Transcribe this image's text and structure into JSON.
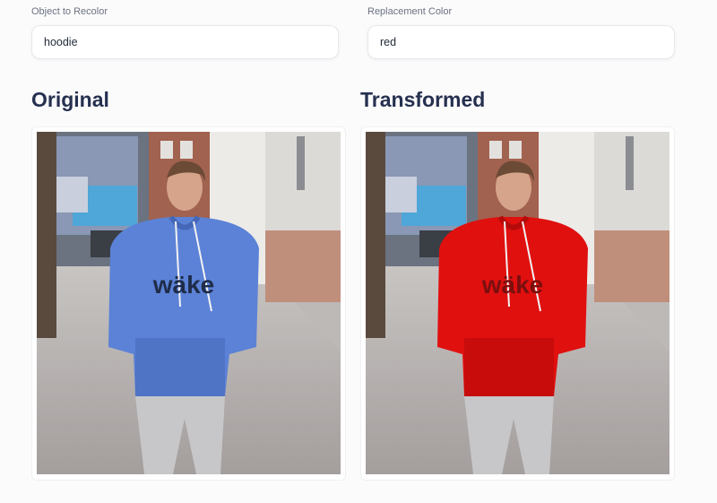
{
  "object_field": {
    "label": "Object to Recolor",
    "value": "hoodie"
  },
  "color_field": {
    "label": "Replacement Color",
    "value": "red"
  },
  "original": {
    "heading": "Original",
    "garment_color": "#5b82d6",
    "garment_shade": "#4667b8",
    "print_text": "wäke"
  },
  "transformed": {
    "heading": "Transformed",
    "garment_color": "#e0100f",
    "garment_shade": "#b50a0a",
    "print_text": "wäke"
  }
}
